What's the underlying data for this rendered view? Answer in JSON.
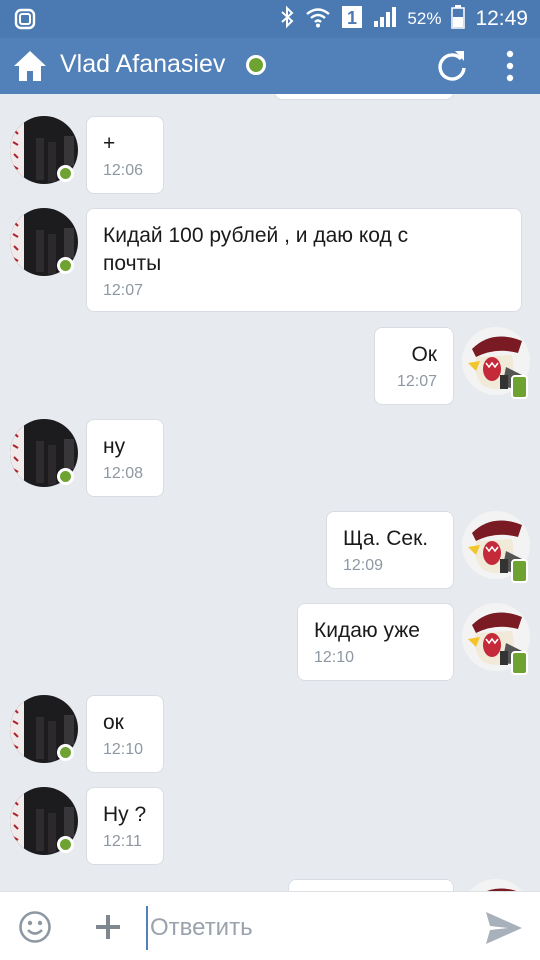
{
  "status_bar": {
    "battery": "52%",
    "time": "12:49",
    "sim": "1",
    "icons": [
      "screen-icon",
      "bluetooth-icon",
      "wifi-icon",
      "sim-icon",
      "signal-icon",
      "battery-icon"
    ]
  },
  "header": {
    "title": "Vlad Afanasiev",
    "online": true,
    "icons": [
      "home-icon",
      "refresh-icon",
      "more-vert-icon"
    ]
  },
  "messages": [
    {
      "dir": "in",
      "text": "+",
      "time": "12:06"
    },
    {
      "dir": "in",
      "text": "Кидай 100 рублей , и даю код с",
      "text2": "почты",
      "time": "12:07"
    },
    {
      "dir": "out",
      "text": "Ок",
      "time": "12:07"
    },
    {
      "dir": "in",
      "text": "ну",
      "time": "12:08"
    },
    {
      "dir": "out",
      "text": "Ща. Сек.",
      "time": "12:09"
    },
    {
      "dir": "out",
      "text": "Кидаю уже",
      "time": "12:10"
    },
    {
      "dir": "in",
      "text": "ок",
      "time": "12:10"
    },
    {
      "dir": "in",
      "text": "Ну ?",
      "time": "12:11"
    }
  ],
  "composer": {
    "placeholder": "Ответить",
    "icons": [
      "emoji-icon",
      "plus-icon",
      "send-icon"
    ]
  },
  "colors": {
    "status_bar": "#4a7ab1",
    "header": "#5181b8",
    "background": "#e7ebf0",
    "online": "#6fa331",
    "time_text": "#8e98a3"
  }
}
